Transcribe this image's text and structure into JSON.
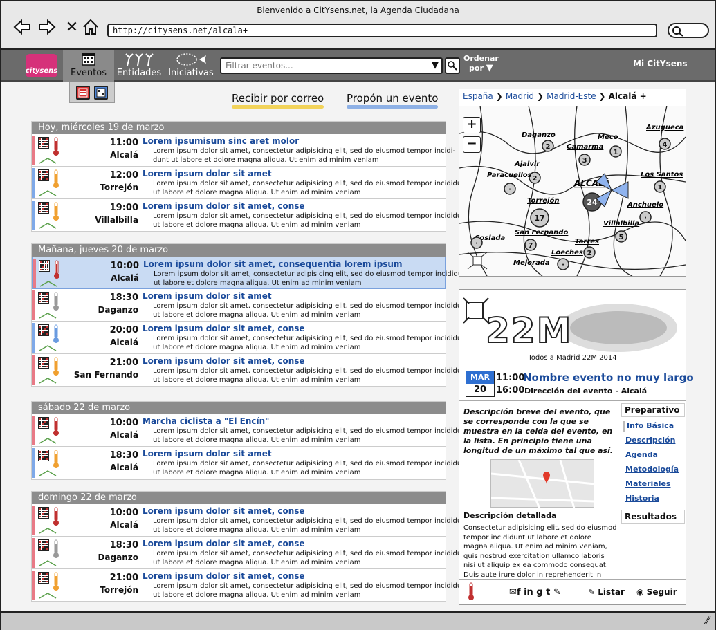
{
  "window": {
    "title": "Bienvenido a CitYsens.net, la Agenda Ciudadana",
    "url": "http://citysens.net/alcala+"
  },
  "nav": {
    "logo": "citysens",
    "tabs": [
      {
        "label": "Eventos",
        "icon": "calendar-icon"
      },
      {
        "label": "Entidades",
        "icon": "people-icon"
      },
      {
        "label": "Iniciativas",
        "icon": "fish-icon"
      }
    ],
    "filter_placeholder": "Filtrar eventos...",
    "order_label_1": "Ordenar",
    "order_label_2": "por",
    "account": "Mi CitYsens"
  },
  "actions": {
    "email": "Recibir por correo",
    "propose": "Propón un evento"
  },
  "days": [
    {
      "header": "Hoy, miércoles 19 de marzo",
      "events": [
        {
          "time": "11:00",
          "place": "Alcalá",
          "title": "Lorem ipsumisum sinc aret molor",
          "desc": "Lorem ipsum dolor sit amet, consectetur adipisicing elit, sed do eiusmod tempor incidi-\ndunt ut labore et dolore magna aliqua. Ut enim ad minim veniam",
          "side": "#e87a86",
          "therm": "#c03030",
          "cal": "#c03030"
        },
        {
          "time": "12:00",
          "place": "Torrejón",
          "title": "Lorem ipsum dolor sit amet",
          "desc": "Lorem ipsum dolor sit amet, consectetur adipisicing elit, sed do eiusmod tempor incididunt\nut labore et dolore magna aliqua. Ut enim ad minim veniam",
          "side": "#7fa9e8",
          "therm": "#f0a030",
          "cal": "#c03030"
        },
        {
          "time": "19:00",
          "place": "Villalbilla",
          "title": "Lorem ipsum dolor sit amet, conse",
          "desc": "Lorem ipsum dolor sit amet, consectetur adipisicing elit, sed do eiusmod tempor incididunt\nut labore et dolore magna aliqua. Ut enim ad minim veniam",
          "side": "#7fa9e8",
          "therm": "#f0a030",
          "cal": "#c03030"
        }
      ]
    },
    {
      "header": "Mañana, jueves 20 de marzo",
      "events": [
        {
          "time": "10:00",
          "place": "Alcalá",
          "title": "Lorem ipsum dolor sit amet, consequentia lorem ipsum",
          "desc": "Lorem ipsum dolor sit amet, consectetur adipisicing elit, sed do eiusmod tempor incididunt\nut labore et dolore magna aliqua. Ut enim ad minim veniam",
          "side": "#e87a86",
          "therm": "#c03030",
          "cal": "#c03030",
          "selected": true
        },
        {
          "time": "18:30",
          "place": "Daganzo",
          "title": "Lorem ipsum dolor sit amet",
          "desc": "Lorem ipsum dolor sit amet, consectetur adipisicing elit, sed do eiusmod tempor incididunt\nut labore et dolore magna aliqua. Ut enim ad minim veniam",
          "side": "#e87a86",
          "therm": "#999999",
          "cal": "#c03030"
        },
        {
          "time": "20:00",
          "place": "Alcalá",
          "title": "Lorem ipsum dolor sit amet, conse",
          "desc": "Lorem ipsum dolor sit amet, consectetur adipisicing elit, sed do eiusmod tempor incididunt\nut labore et dolore magna aliqua. Ut enim ad minim veniam",
          "side": "#7fa9e8",
          "therm": "#6a9be0",
          "cal": "#c03030"
        },
        {
          "time": "21:00",
          "place": "San Fernando",
          "title": "Lorem ipsum dolor sit amet, conse",
          "desc": "Lorem ipsum dolor sit amet, consectetur adipisicing elit, sed do eiusmod tempor incididunt\nut labore et dolore magna aliqua. Ut enim ad minim veniam",
          "side": "#e87a86",
          "therm": "#f0a030",
          "cal": "#c03030"
        }
      ]
    },
    {
      "header": "sábado 22 de marzo",
      "events": [
        {
          "time": "10:00",
          "place": "Alcalá",
          "title": "Marcha ciclista a \"El Encín\"",
          "desc": "Lorem ipsum dolor sit amet, consectetur adipisicing elit, sed do eiusmod tempor incididunt\nut labore et dolore magna aliqua. Ut enim ad minim veniam",
          "side": "#e87a86",
          "therm": "#c03030",
          "cal": "#c03030"
        },
        {
          "time": "18:30",
          "place": "Alcalá",
          "title": "Lorem ipsum dolor sit amet",
          "desc": "Lorem ipsum dolor sit amet, consectetur adipisicing elit, sed do eiusmod tempor incididunt\nut labore et dolore magna aliqua. Ut enim ad minim veniam",
          "side": "#7fa9e8",
          "therm": "#f0a030",
          "cal": "#c03030"
        }
      ]
    },
    {
      "header": "domingo 22 de marzo",
      "events": [
        {
          "time": "10:00",
          "place": "Alcalá",
          "title": "Lorem ipsum dolor sit amet, conse",
          "desc": "Lorem ipsum dolor sit amet, consectetur adipisicing elit, sed do eiusmod tempor incididunt\nut labore et dolore magna aliqua. Ut enim ad minim veniam",
          "side": "#e87a86",
          "therm": "#c03030",
          "cal": "#c03030"
        },
        {
          "time": "18:30",
          "place": "Daganzo",
          "title": "Lorem ipsum dolor sit amet, conse",
          "desc": "Lorem ipsum dolor sit amet, consectetur adipisicing elit, sed do eiusmod tempor incididunt\nut labore et dolore magna aliqua. Ut enim ad minim veniam",
          "side": "#e87a86",
          "therm": "#999999",
          "cal": "#c03030"
        },
        {
          "time": "21:00",
          "place": "Torrejón",
          "title": "Lorem ipsum dolor sit amet, conse",
          "desc": "Lorem ipsum dolor sit amet, consectetur adipisicing elit, sed do eiusmod tempor incididunt\nut labore et dolore magna aliqua. Ut enim ad minim veniam",
          "side": "#e87a86",
          "therm": "#f0a030",
          "cal": "#c03030"
        }
      ]
    }
  ],
  "map": {
    "breadcrumb": [
      "España",
      "Madrid",
      "Madrid-Este",
      "Alcalá +"
    ],
    "places": [
      {
        "name": "Daganzo",
        "count": "2"
      },
      {
        "name": "Meco",
        "count": "1"
      },
      {
        "name": "Azugueca",
        "count": "4"
      },
      {
        "name": "Camarma",
        "count": "3"
      },
      {
        "name": "Ajalvir",
        "count": "2"
      },
      {
        "name": "Paracuellos",
        "count": "·"
      },
      {
        "name": "Los Santos",
        "count": "1"
      },
      {
        "name": "ALCALÁ",
        "count": "24"
      },
      {
        "name": "Torrejón",
        "count": "17"
      },
      {
        "name": "Anchuelo",
        "count": "·"
      },
      {
        "name": "Villalbilla",
        "count": "5"
      },
      {
        "name": "San Fernando",
        "count": "7"
      },
      {
        "name": "Coslada",
        "count": "·"
      },
      {
        "name": "Torres",
        "count": "2"
      },
      {
        "name": "Loeches",
        "count": "·"
      },
      {
        "name": "Mejorada",
        "count": ""
      }
    ]
  },
  "detail": {
    "banner_big": "22M",
    "banner_caption": "Todos a Madrid 22M 2014",
    "month": "MAR",
    "day": "20",
    "start": "11:00",
    "end": "16:00",
    "name": "Nombre evento no muy largo",
    "address": "Dirección del evento - Alcalá",
    "brief": "Descripción breve del evento, que se corresponde con la que se muestra en la celda del evento, en la lista. En principio tiene una longitud de un máximo tal que así.",
    "detail_heading": "Descripción detallada",
    "detail_text": "Consectetur adipisicing elit, sed do eiusmod tempor incididunt ut labore et dolore magna aliqua. Ut enim ad minim veniam, quis nostrud exercitation ullamco laboris nisi ut aliquip ex ea commodo consequat. Duis aute irure dolor in reprehenderit in voluptate velit",
    "tab_prep": "Preparativo",
    "links": [
      "Info Básica",
      "Descripción",
      "Agenda",
      "Metodología",
      "Materiales",
      "Historia"
    ],
    "tab_results": "Resultados",
    "share_icons": "✉f in g t ✎",
    "list_label": "Listar",
    "follow_label": "Seguir"
  }
}
